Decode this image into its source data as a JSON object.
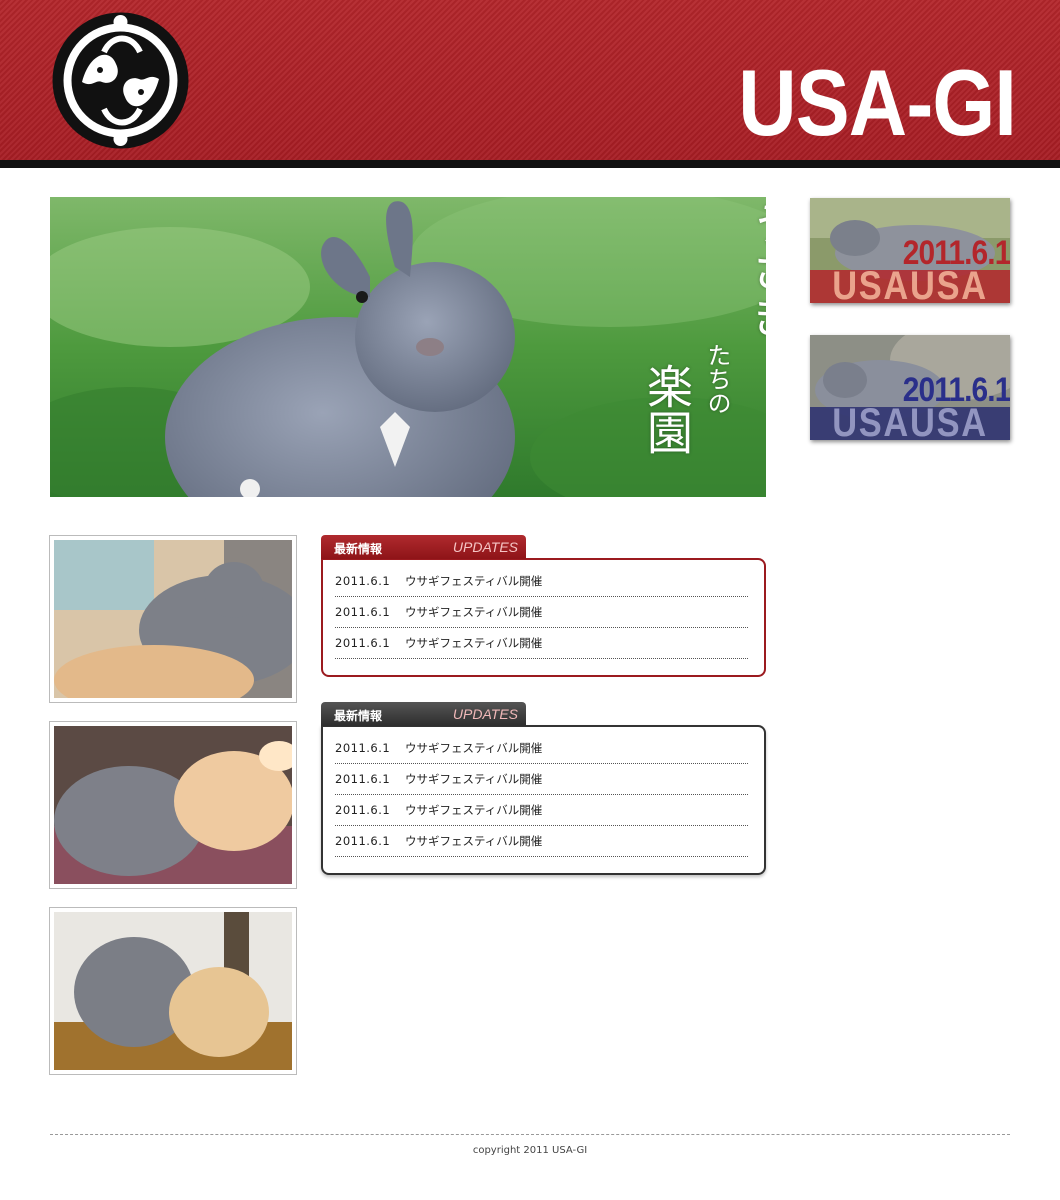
{
  "header": {
    "brand": "USA-GI"
  },
  "hero": {
    "line1": "うさぎ",
    "line2": "たちの",
    "line3": "楽園"
  },
  "banners": [
    {
      "date": "2011.6.1",
      "word": "USAUSA"
    },
    {
      "date": "2011.6.1",
      "word": "USAUSA"
    }
  ],
  "news_boxes": [
    {
      "title_jp": "最新情報",
      "title_en": "UPDATES",
      "items": [
        {
          "date": "2011.6.1",
          "text": "ウサギフェスティバル開催"
        },
        {
          "date": "2011.6.1",
          "text": "ウサギフェスティバル開催"
        },
        {
          "date": "2011.6.1",
          "text": "ウサギフェスティバル開催"
        }
      ]
    },
    {
      "title_jp": "最新情報",
      "title_en": "UPDATES",
      "items": [
        {
          "date": "2011.6.1",
          "text": "ウサギフェスティバル開催"
        },
        {
          "date": "2011.6.1",
          "text": "ウサギフェスティバル開催"
        },
        {
          "date": "2011.6.1",
          "text": "ウサギフェスティバル開催"
        },
        {
          "date": "2011.6.1",
          "text": "ウサギフェスティバル開催"
        }
      ]
    }
  ],
  "footer": {
    "copyright": "copyright 2011 USA-GI"
  },
  "colors": {
    "header_red": "#b3262b",
    "accent_dark_red": "#9b1a1f",
    "dark_gray": "#333333",
    "banner_blue": "#2a2f8a"
  }
}
